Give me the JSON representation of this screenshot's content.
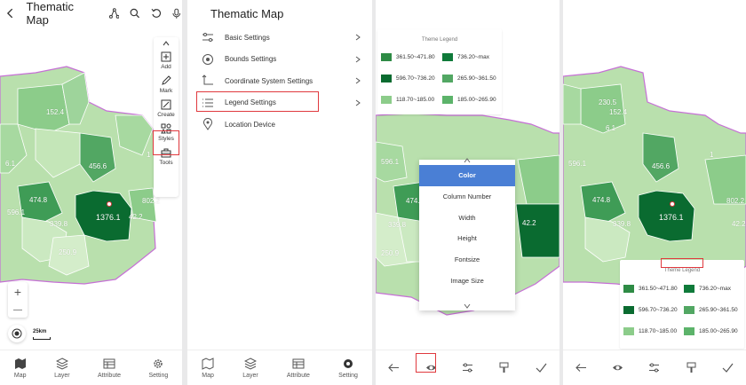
{
  "colors": {
    "accent_blue": "#4a7fd5",
    "highlight_red": "#e0393e",
    "c1": "#2e8b45",
    "c2": "#0a6b30",
    "c3": "#0f7a3a",
    "c4": "#52a763",
    "c5": "#8ccc8a",
    "c6": "#5cb36a",
    "base": "#b9e0ad",
    "light": "#d4edca"
  },
  "panel1": {
    "title": "Thematic Map",
    "map_labels": [
      "152.4",
      "456.6",
      "474.8",
      "1376.1",
      "802.2",
      "339.8",
      "250.9",
      "6.1",
      "596.1",
      "42.2",
      "230.5",
      "1"
    ],
    "right_tools": [
      "Add",
      "Mark",
      "Create",
      "Styles",
      "Tools"
    ],
    "scale_text": "25km",
    "zoom_in": "+",
    "zoom_out": "—",
    "tabs": [
      "Map",
      "Layer",
      "Attribute",
      "Setting"
    ]
  },
  "panel2": {
    "title": "Thematic Map",
    "menu_items": [
      "Basic Settings",
      "Bounds Settings",
      "Coordinate System Settings",
      "Legend Settings",
      "Location Device"
    ],
    "tabs": [
      "Map",
      "Layer",
      "Attribute",
      "Setting"
    ]
  },
  "panel3": {
    "legend_title": "Theme Legend",
    "legend_items": [
      "361.50~471.80",
      "736.20~max",
      "596.70~736.20",
      "265.90~361.50",
      "118.70~185.00",
      "185.00~265.90"
    ],
    "map_labels": [
      "596.1",
      "474.8",
      "339.8",
      "250.9",
      "42.2"
    ],
    "popup_items": [
      "Color",
      "Column Number",
      "Width",
      "Height",
      "Fontsize",
      "Image Size"
    ],
    "popup_selected": "Color"
  },
  "panel4": {
    "legend_title": "Theme Legend",
    "legend_items": [
      "361.50~471.80",
      "736.20~max",
      "596.70~736.20",
      "265.90~361.50",
      "118.70~185.00",
      "185.00~265.90"
    ],
    "map_labels": [
      "230.5",
      "152.4",
      "456.6",
      "474.8",
      "1376.1",
      "802.2",
      "596.1",
      "339.8",
      "6.1",
      "42.2",
      "1"
    ]
  }
}
